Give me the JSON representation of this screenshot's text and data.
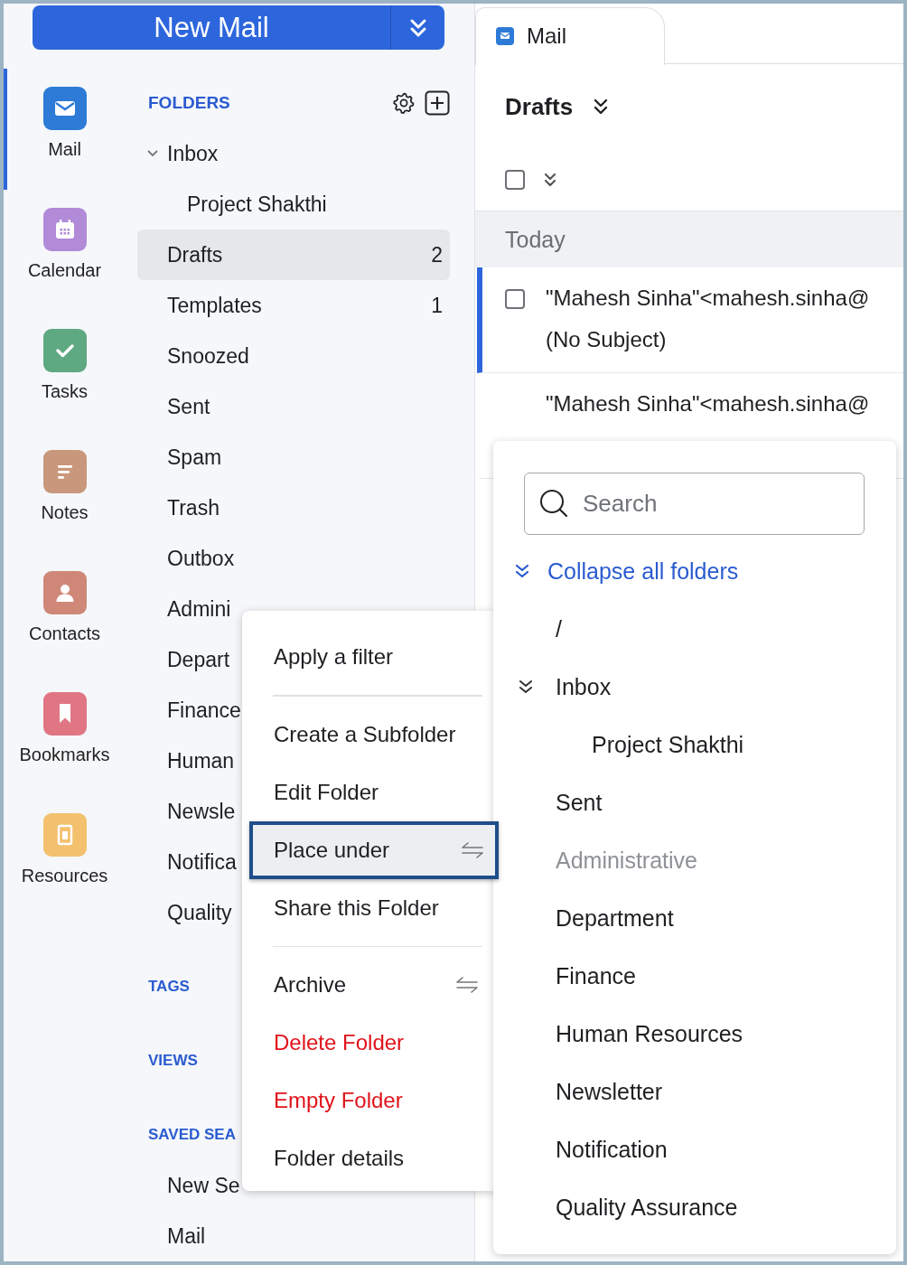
{
  "new_mail_button": {
    "label": "New Mail"
  },
  "apps": [
    {
      "label": "Mail",
      "kind": "mail",
      "color": "#2d7bd6",
      "selected": true
    },
    {
      "label": "Calendar",
      "kind": "calendar",
      "color": "#b18ad8",
      "selected": false
    },
    {
      "label": "Tasks",
      "kind": "tasks",
      "color": "#5fa982",
      "selected": false
    },
    {
      "label": "Notes",
      "kind": "notes",
      "color": "#c9977b",
      "selected": false
    },
    {
      "label": "Contacts",
      "kind": "contacts",
      "color": "#cf8878",
      "selected": false
    },
    {
      "label": "Bookmarks",
      "kind": "bookmarks",
      "color": "#e07684",
      "selected": false
    },
    {
      "label": "Resources",
      "kind": "resources",
      "color": "#f3c16e",
      "selected": false
    }
  ],
  "folders": {
    "heading": "FOLDERS",
    "items": [
      {
        "name": "Inbox",
        "selected": false,
        "expanded": true,
        "children": [
          {
            "name": "Project Shakthi",
            "selected": false
          }
        ]
      },
      {
        "name": "Drafts",
        "count": "2",
        "selected": true
      },
      {
        "name": "Templates",
        "count": "1",
        "selected": false
      },
      {
        "name": "Snoozed",
        "selected": false
      },
      {
        "name": "Sent",
        "selected": false
      },
      {
        "name": "Spam",
        "selected": false
      },
      {
        "name": "Trash",
        "selected": false
      },
      {
        "name": "Outbox",
        "selected": false
      },
      {
        "name": "Admini",
        "selected": false
      },
      {
        "name": "Depart",
        "selected": false
      },
      {
        "name": "Finance",
        "selected": false
      },
      {
        "name": "Human",
        "selected": false
      },
      {
        "name": "Newsle",
        "selected": false
      },
      {
        "name": "Notifica",
        "selected": false
      },
      {
        "name": "Quality",
        "selected": false
      }
    ]
  },
  "sections": [
    {
      "heading": "TAGS"
    },
    {
      "heading": "VIEWS"
    },
    {
      "heading": "SAVED SEA",
      "items": [
        "New Se",
        "Mail"
      ]
    }
  ],
  "tab": {
    "title": "Mail"
  },
  "list": {
    "title": "Drafts",
    "select_all": {
      "checked": false
    },
    "groups": [
      {
        "label": "Today",
        "messages": [
          {
            "from": "\"Mahesh Sinha\"<mahesh.sinha@",
            "subject": "(No Subject)",
            "selected": true
          },
          {
            "from": "\"Mahesh Sinha\"<mahesh.sinha@",
            "selected": false
          }
        ]
      }
    ]
  },
  "context_menu": {
    "groups": [
      [
        {
          "label": "Apply a filter",
          "kind": "normal",
          "selected": false,
          "submenu": false
        }
      ],
      [
        {
          "label": "Create a Subfolder",
          "kind": "normal",
          "selected": false,
          "submenu": false
        },
        {
          "label": "Edit Folder",
          "kind": "normal",
          "selected": false,
          "submenu": false
        },
        {
          "label": "Place under",
          "kind": "normal",
          "selected": true,
          "submenu": true
        },
        {
          "label": "Share this Folder",
          "kind": "normal",
          "selected": false,
          "submenu": false
        }
      ],
      [
        {
          "label": "Archive",
          "kind": "normal",
          "selected": false,
          "submenu": true
        },
        {
          "label": "Delete Folder",
          "kind": "danger",
          "selected": false,
          "submenu": false
        },
        {
          "label": "Empty Folder",
          "kind": "danger",
          "selected": false,
          "submenu": false
        },
        {
          "label": "Folder details",
          "kind": "normal",
          "selected": false,
          "submenu": false
        }
      ]
    ]
  },
  "folder_picker": {
    "search": {
      "placeholder": "Search"
    },
    "collapse_label": "Collapse all folders",
    "folders": [
      {
        "name": "/",
        "disabled": false
      },
      {
        "name": "Inbox",
        "disabled": false,
        "expanded": true,
        "children": [
          {
            "name": "Project Shakthi",
            "disabled": false
          }
        ]
      },
      {
        "name": "Sent",
        "disabled": false
      },
      {
        "name": "Administrative",
        "disabled": true
      },
      {
        "name": "Department",
        "disabled": false
      },
      {
        "name": "Finance",
        "disabled": false
      },
      {
        "name": "Human Resources",
        "disabled": false
      },
      {
        "name": "Newsletter",
        "disabled": false
      },
      {
        "name": "Notification",
        "disabled": false
      },
      {
        "name": "Quality Assurance",
        "disabled": false
      }
    ]
  }
}
